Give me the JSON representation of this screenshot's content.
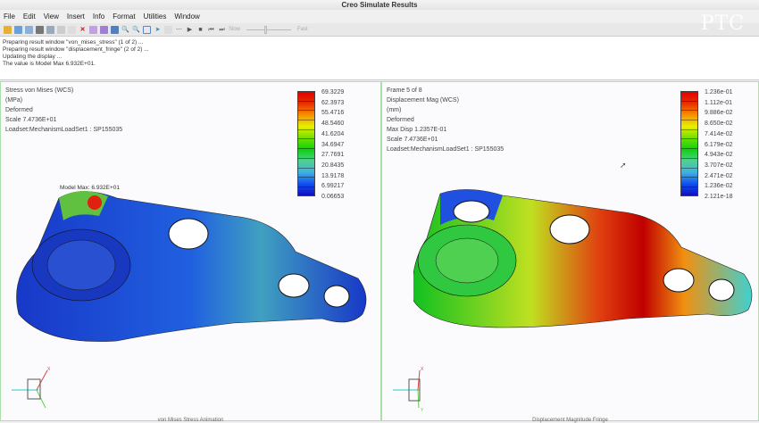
{
  "window": {
    "title": "Creo Simulate Results"
  },
  "menu": [
    "File",
    "Edit",
    "View",
    "Insert",
    "Info",
    "Format",
    "Utilities",
    "Window"
  ],
  "toolbar": {
    "slow": "Slow",
    "fast": "Fast",
    "animation_speed": 0.4
  },
  "logo": "PTC",
  "messages": [
    "Preparing result window \"von_mises_stress\" (1 of 2) ...",
    "Preparing result window \"displacement_fringe\" (2 of 2) ...",
    "Updating the display ...",
    "The value is Model Max   6.932E+01."
  ],
  "left": {
    "info": [
      "Stress von Mises (WCS)",
      "(MPa)",
      "Deformed",
      "Scale  7.4736E+01",
      "Loadset:MechanismLoadSet1 :   SP155035"
    ],
    "legend": [
      "69.3229",
      "62.3973",
      "55.4716",
      "48.5460",
      "41.6204",
      "34.6947",
      "27.7691",
      "20.8435",
      "13.9178",
      "6.99217",
      "0.06653"
    ],
    "max_label": "Model Max: 6.932E+01",
    "caption": "von Mises Stress Animation"
  },
  "right": {
    "info": [
      "Frame 5 of 8",
      "Displacement Mag (WCS)",
      "(mm)",
      "Deformed",
      "Max Disp  1.2357E-01",
      "Scale  7.4736E+01",
      "Loadset:MechanismLoadSet1 :   SP155035"
    ],
    "legend": [
      "1.236e-01",
      "1.112e-01",
      "9.886e-02",
      "8.650e-02",
      "7.414e-02",
      "6.179e-02",
      "4.943e-02",
      "3.707e-02",
      "2.471e-02",
      "1.236e-02",
      "2.121e-18"
    ],
    "caption": "Displacement Magnitude Fringe"
  },
  "triad": {
    "x": "X",
    "y": "Y"
  }
}
